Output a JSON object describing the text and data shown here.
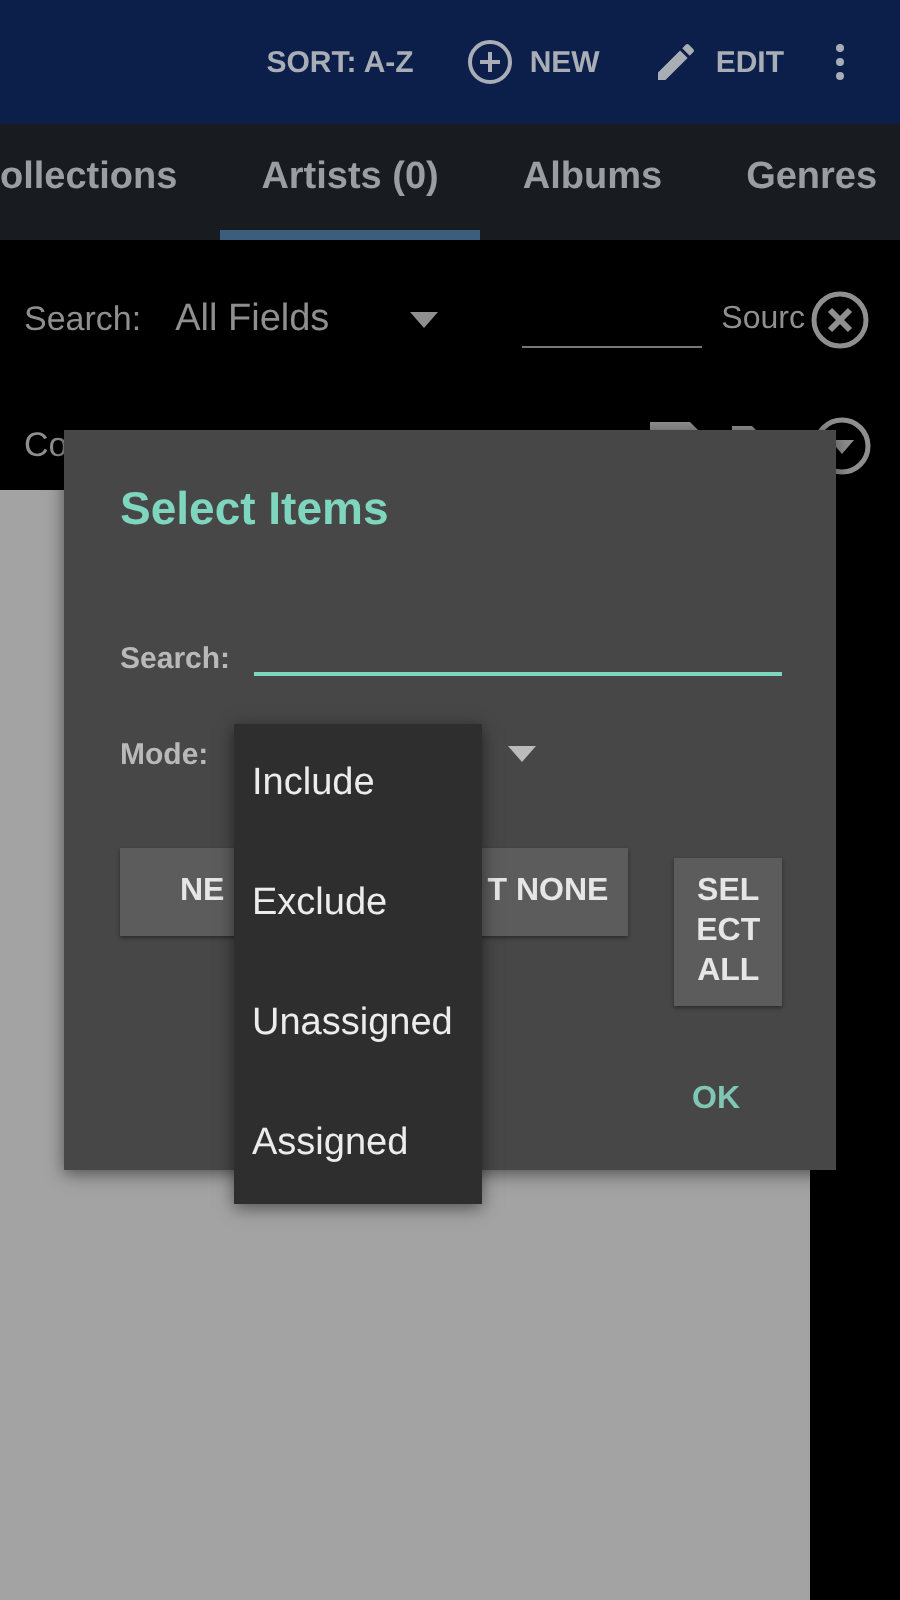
{
  "toolbar": {
    "actions": [
      {
        "kind": "text",
        "label": "SORT: A-Z"
      },
      {
        "kind": "add",
        "label": "NEW"
      },
      {
        "kind": "edit",
        "label": "EDIT"
      },
      {
        "kind": "more"
      }
    ]
  },
  "tabs": [
    {
      "label": "ollections",
      "selected": false
    },
    {
      "label": "Artists (0)",
      "selected": true
    },
    {
      "label": "Albums",
      "selected": false
    },
    {
      "label": "Genres",
      "selected": false
    }
  ],
  "filter": {
    "search_label": "Search:",
    "field": "All Fields",
    "source_label": "Sourc",
    "row2_label": "Co"
  },
  "dialog": {
    "title": "Select Items",
    "search_label": "Search:",
    "mode_label": "Mode:",
    "buttons": [
      {
        "label": "NE",
        "kind": "left"
      },
      {
        "label": "T NONE",
        "kind": "right"
      },
      {
        "label": "SELECT ALL",
        "kind": "narrow"
      }
    ],
    "ok": "OK"
  },
  "mode_menu": {
    "options": [
      "Include",
      "Exclude",
      "Unassigned",
      "Assigned"
    ]
  }
}
